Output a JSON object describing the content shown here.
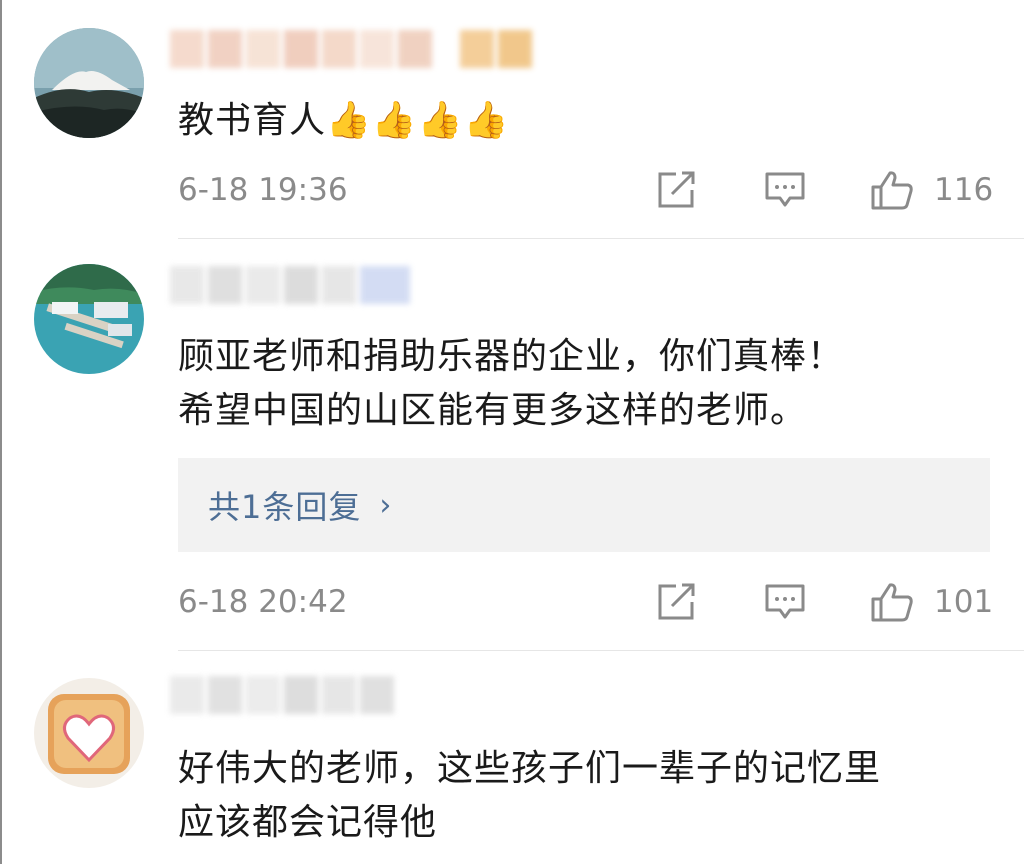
{
  "comments": [
    {
      "text_lines": [
        "教书育人👍👍👍👍"
      ],
      "time": "6-18 19:36",
      "likes": "116",
      "avatar_icon": "mountain-landscape-avatar"
    },
    {
      "text_lines": [
        "顾亚老师和捐助乐器的企业，你们真棒！",
        "希望中国的山区能有更多这样的老师。"
      ],
      "replies_label": "共1条回复",
      "time": "6-18 20:42",
      "likes": "101",
      "avatar_icon": "lakeside-pier-avatar"
    },
    {
      "text_lines": [
        "好伟大的老师，这些孩子们一辈子的记忆里",
        "应该都会记得他"
      ],
      "avatar_icon": "heart-toast-avatar"
    }
  ],
  "icons": {
    "share": "share-icon",
    "comment": "comment-icon",
    "like": "thumbs-up-icon",
    "reply_chevron": "chevron-right-icon"
  },
  "colors": {
    "link": "#4d6e95",
    "meta_gray": "#8a8a8a",
    "reply_bg": "#f2f2f2"
  }
}
